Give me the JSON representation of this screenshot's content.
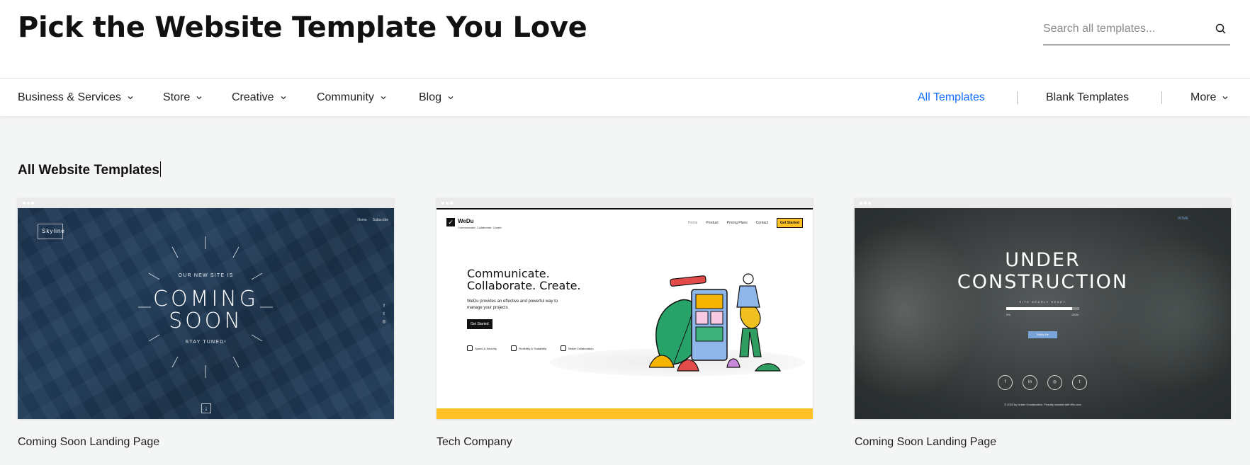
{
  "header": {
    "title": "Pick the Website Template You Love",
    "search_placeholder": "Search all templates..."
  },
  "nav": {
    "left": [
      {
        "label": "Business & Services"
      },
      {
        "label": "Store"
      },
      {
        "label": "Creative"
      },
      {
        "label": "Community"
      },
      {
        "label": "Blog"
      }
    ],
    "right": {
      "all": "All Templates",
      "blank": "Blank Templates",
      "more": "More"
    },
    "active_color": "#116dff"
  },
  "section": {
    "title": "All Website Templates"
  },
  "cards": [
    {
      "caption": "Coming Soon Landing Page",
      "preview": {
        "logo": "Skyline",
        "nav": [
          "Home",
          "Subscribe"
        ],
        "kicker": "OUR NEW SITE IS",
        "line1": "COMING",
        "line2": "SOON",
        "footer": "STAY TUNED!",
        "social_icons": [
          "facebook-icon",
          "twitter-icon",
          "instagram-icon"
        ],
        "down": "↓"
      }
    },
    {
      "caption": "Tech Company",
      "preview": {
        "brand": "WeDu",
        "tagline": "Communicate. Collaborate. Create.",
        "nav": [
          "Home",
          "Product",
          "Pricing Plans",
          "Contact"
        ],
        "nav_button": "Get Started",
        "headline1": "Communicate.",
        "headline2": "Collaborate. Create.",
        "description": "WeDu provides an effective and powerful way to manage your projects",
        "cta": "Get Started",
        "features": [
          "Speed & Security",
          "Flexibility & Scalability",
          "Better Collaboration"
        ],
        "accent": "#ffc126"
      }
    },
    {
      "caption": "Coming Soon Landing Page",
      "preview": {
        "nav": "HOME",
        "line1": "UNDER",
        "line2": "CONSTRUCTION",
        "sub": "SITE NEARLY READY",
        "progress_start": "0%",
        "progress_end": "100%",
        "progress": 0.9,
        "button": "Notify Me",
        "social": [
          "f",
          "in",
          "◎",
          "t"
        ],
        "copyright": "© 2023 by Under Construction. Proudly created with Wix.com"
      }
    }
  ]
}
